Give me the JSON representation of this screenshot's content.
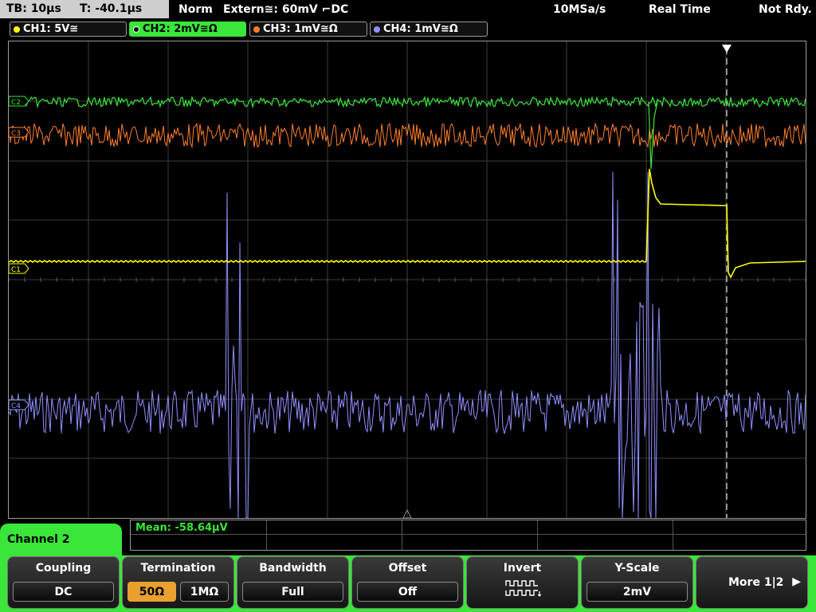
{
  "status_bar": {
    "timebase": "TB: 10µs",
    "trigger_time": "T: -40.1µs",
    "mode": "Norm",
    "trigger": "Extern≅: 60mV ⌐DC",
    "sample_rate": "10MSa/s",
    "acquisition": "Real Time",
    "state": "Not Rdy."
  },
  "channels": [
    {
      "label": "CH1: 5V≅",
      "color": "#ffff00"
    },
    {
      "label": "CH2: 2mV≅Ω",
      "color": "#39e639",
      "active": true
    },
    {
      "label": "CH3: 1mV≅Ω",
      "color": "#ff7f2a"
    },
    {
      "label": "CH4: 1mV≅Ω",
      "color": "#9090ff"
    }
  ],
  "waveform_markers": {
    "ch2": "C2",
    "ch3": "C3",
    "ch1": "C1",
    "ch4": "C4"
  },
  "measurement": {
    "text": "Mean: -58.64µV"
  },
  "menu": {
    "channel_tab": "Channel 2",
    "coupling": {
      "title": "Coupling",
      "value": "DC"
    },
    "termination": {
      "title": "Termination",
      "option_a": "50Ω",
      "option_b": "1MΩ",
      "selected": "50Ω"
    },
    "bandwidth": {
      "title": "Bandwidth",
      "value": "Full"
    },
    "offset": {
      "title": "Offset",
      "value": "Off"
    },
    "invert": {
      "title": "Invert",
      "icon": "invert-waveform-icon"
    },
    "yscale": {
      "title": "Y-Scale",
      "value": "2mV"
    },
    "more": {
      "label": "More 1|2"
    }
  },
  "colors": {
    "ch1": "#ffff00",
    "ch2": "#39e639",
    "ch3": "#ff7f2a",
    "ch4": "#9090ff",
    "grid": "#3c3c3c",
    "accent": "#39e639",
    "selected": "#e8a030"
  }
}
